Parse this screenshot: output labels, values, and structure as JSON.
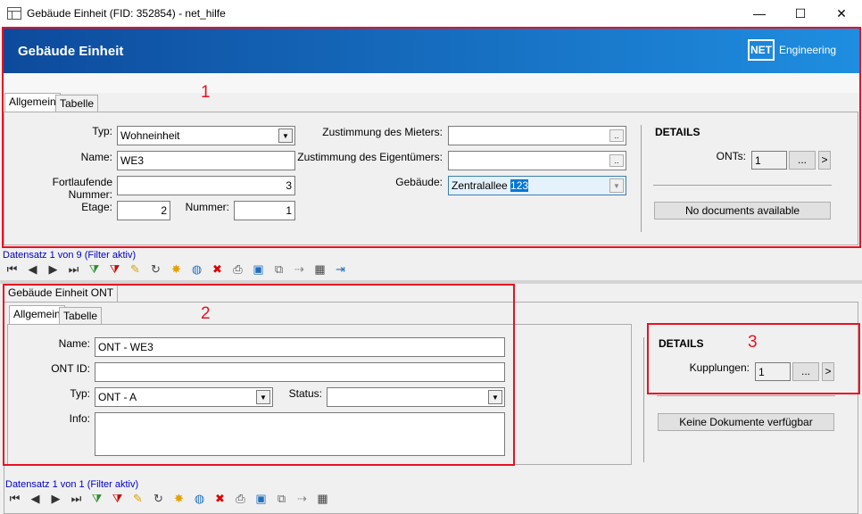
{
  "window": {
    "title": "Gebäude Einheit (FID: 352854) - net_hilfe",
    "controls": {
      "minimize": "—",
      "maximize": "☐",
      "close": "✕"
    }
  },
  "header": {
    "title": "Gebäude Einheit",
    "logo_box": "NET",
    "logo_word": "Engineering"
  },
  "top": {
    "tabs": [
      "Allgemein",
      "Tabelle"
    ],
    "fields": {
      "typ_label": "Typ:",
      "typ_value": "Wohneinheit",
      "name_label": "Name:",
      "name_value": "WE3",
      "fortlaufende_label": "Fortlaufende Nummer:",
      "fortlaufende_value": "3",
      "etage_label": "Etage:",
      "etage_value": "2",
      "nummer_label": "Nummer:",
      "nummer_value": "1",
      "zust_mieter_label": "Zustimmung des Mieters:",
      "zust_mieter_value": "",
      "zust_eigen_label": "Zustimmung des Eigentümers:",
      "zust_eigen_value": "",
      "gebaeude_label": "Gebäude:",
      "gebaeude_value_prefix": "Zentralallee ",
      "gebaeude_value_hl": "123"
    },
    "details": {
      "title": "DETAILS",
      "onts_label": "ONTs:",
      "onts_value": "1",
      "more_btn": "...",
      "next_btn": ">",
      "docs_button": "No documents available"
    },
    "nav_text": "Datensatz 1 von 9 (Filter aktiv)"
  },
  "bottom": {
    "group_tab": "Gebäude Einheit ONT",
    "tabs": [
      "Allgemein",
      "Tabelle"
    ],
    "fields": {
      "name_label": "Name:",
      "name_value": "ONT - WE3",
      "ontid_label": "ONT ID:",
      "ontid_value": "",
      "typ_label": "Typ:",
      "typ_value": "ONT - A",
      "status_label": "Status:",
      "status_value": "",
      "info_label": "Info:",
      "info_value": ""
    },
    "details": {
      "title": "DETAILS",
      "kupplungen_label": "Kupplungen:",
      "kupplungen_value": "1",
      "more_btn": "...",
      "next_btn": ">",
      "docs_button": "Keine Dokumente verfügbar"
    },
    "nav_text": "Datensatz 1 von 1 (Filter aktiv)"
  },
  "annotations": {
    "box1": "1",
    "box2": "2",
    "box3": "3"
  },
  "toolbar_icons": [
    {
      "name": "first-record-icon",
      "glyph": "⏮",
      "color": "#333"
    },
    {
      "name": "prev-record-icon",
      "glyph": "◀",
      "color": "#333"
    },
    {
      "name": "next-record-icon",
      "glyph": "▶",
      "color": "#333"
    },
    {
      "name": "last-record-icon",
      "glyph": "⏭",
      "color": "#333"
    },
    {
      "name": "filter-add-icon",
      "glyph": "⧩",
      "color": "#2a8f2a"
    },
    {
      "name": "filter-remove-icon",
      "glyph": "⧩",
      "color": "#c00"
    },
    {
      "name": "edit-pencil-icon",
      "glyph": "✎",
      "color": "#d9a400"
    },
    {
      "name": "refresh-icon",
      "glyph": "↻",
      "color": "#444"
    },
    {
      "name": "new-record-icon",
      "glyph": "✸",
      "color": "#e6a100"
    },
    {
      "name": "globe-icon",
      "glyph": "◍",
      "color": "#1f6fbf"
    },
    {
      "name": "delete-icon",
      "glyph": "✖",
      "color": "#d00"
    },
    {
      "name": "print-icon",
      "glyph": "⎙",
      "color": "#444"
    },
    {
      "name": "zoom-to-icon",
      "glyph": "▣",
      "color": "#1f6fbf"
    },
    {
      "name": "copy-icon",
      "glyph": "⧉",
      "color": "#666"
    },
    {
      "name": "move-icon",
      "glyph": "⇢",
      "color": "#888"
    },
    {
      "name": "table-icon",
      "glyph": "▦",
      "color": "#444"
    },
    {
      "name": "exit-icon",
      "glyph": "⇥",
      "color": "#1f6fbf"
    }
  ],
  "colors": {
    "header_start": "#0d4a9c",
    "header_end": "#1f8ee0",
    "annotation": "#e81123",
    "nav_link": "#0000cc"
  }
}
